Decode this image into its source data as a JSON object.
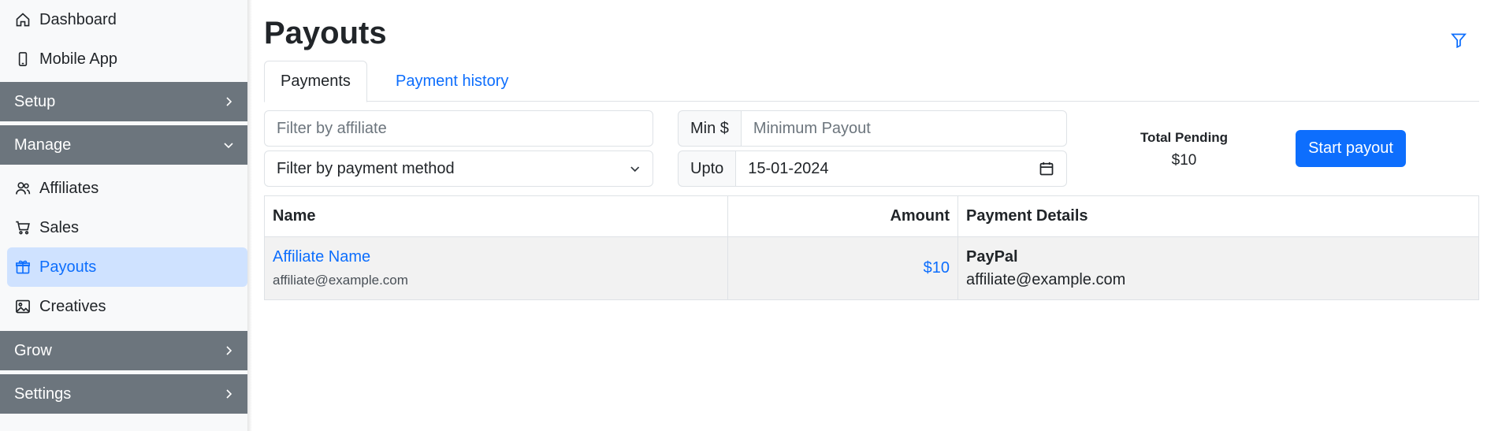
{
  "sidebar": {
    "items": [
      {
        "label": "Dashboard",
        "icon": "house-icon"
      },
      {
        "label": "Mobile App",
        "icon": "phone-icon"
      }
    ],
    "groups": {
      "setup": "Setup",
      "manage": "Manage",
      "grow": "Grow",
      "settings": "Settings"
    },
    "manage_items": [
      {
        "label": "Affiliates",
        "icon": "people-icon"
      },
      {
        "label": "Sales",
        "icon": "cart-icon"
      },
      {
        "label": "Payouts",
        "icon": "gift-icon",
        "active": true
      },
      {
        "label": "Creatives",
        "icon": "image-icon"
      }
    ]
  },
  "page": {
    "title": "Payouts"
  },
  "tabs": [
    {
      "label": "Payments",
      "active": true
    },
    {
      "label": "Payment history",
      "active": false
    }
  ],
  "filters": {
    "affiliate_placeholder": "Filter by affiliate",
    "payment_method_selected": "Filter by payment method",
    "min_addon": "Min $",
    "min_placeholder": "Minimum Payout",
    "upto_addon": "Upto",
    "upto_value": "15-01-2024"
  },
  "summary": {
    "total_pending_label": "Total Pending",
    "total_pending_value": "$10",
    "start_payout_label": "Start payout"
  },
  "table": {
    "headers": {
      "name": "Name",
      "amount": "Amount",
      "details": "Payment Details"
    },
    "rows": [
      {
        "name": "Affiliate Name",
        "email": "affiliate@example.com",
        "amount": "$10",
        "method": "PayPal",
        "detail": "affiliate@example.com"
      }
    ]
  },
  "colors": {
    "primary": "#0d6efd",
    "sidebar_group": "#6c757d",
    "active_bg": "#cfe2ff"
  }
}
